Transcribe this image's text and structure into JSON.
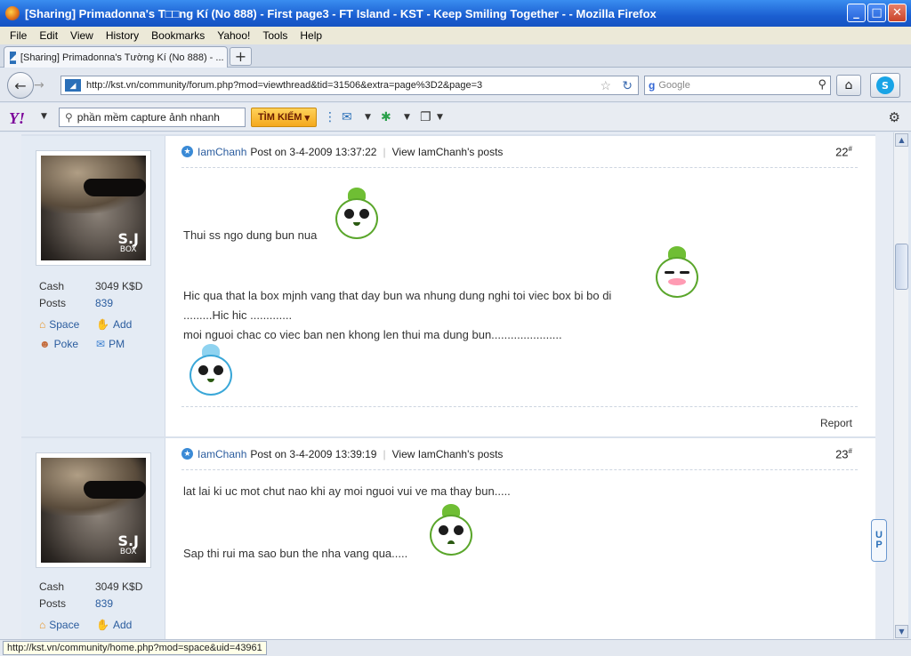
{
  "window": {
    "title": "[Sharing] Primadonna's T□□ng Kí (No 888) - First page3 - FT Island - KST - Keep Smiling Together - - Mozilla Firefox",
    "minimize": "_",
    "maximize": "□",
    "close": "✕"
  },
  "menu": {
    "items": [
      "File",
      "Edit",
      "View",
      "History",
      "Bookmarks",
      "Yahoo!",
      "Tools",
      "Help"
    ]
  },
  "tabs": [
    {
      "label": "[Sharing] Primadonna's Tường Kí (No 888) - ..."
    }
  ],
  "new_tab": "+",
  "nav": {
    "back": "←",
    "forward": "→",
    "url": "http://kst.vn/community/forum.php?mod=viewthread&tid=31506&extra=page%3D2&page=3",
    "search_placeholder": "Google",
    "search_engine_icon": "google-icon",
    "home_icon": "home-icon",
    "skype_icon": "skype-icon"
  },
  "yahoo_toolbar": {
    "logo": "Y!",
    "search_value": "phần mềm capture ảnh nhanh",
    "search_button": "TÌM KIẾM"
  },
  "posts": [
    {
      "author": "IamChanh",
      "posted": "Post on 3-4-2009 13:37:22",
      "view_posts": "View IamChanh's posts",
      "floor": "22",
      "floor_mark": "#",
      "cash_label": "Cash",
      "cash_value": "3049 K$D",
      "posts_label": "Posts",
      "posts_value": "839",
      "actions": [
        "Space",
        "Add",
        "Poke",
        "PM"
      ],
      "lines": [
        "Thui ss ngo dung bun nua",
        "Hic qua that la box mjnh vang that day bun wa nhung dung nghi toi viec box bi bo di",
        ".........Hic hic .............",
        "moi nguoi chac co viec ban nen khong len thui ma dung bun......................"
      ],
      "report": "Report"
    },
    {
      "author": "IamChanh",
      "posted": "Post on 3-4-2009 13:39:19",
      "view_posts": "View IamChanh's posts",
      "floor": "23",
      "floor_mark": "#",
      "cash_label": "Cash",
      "cash_value": "3049 K$D",
      "posts_label": "Posts",
      "posts_value": "839",
      "actions": [
        "Space",
        "Add"
      ],
      "lines": [
        "lat lai ki uc mot chut nao khi ay moi nguoi vui ve ma thay bun.....",
        "Sap thi rui ma sao bun the nha vang qua....."
      ]
    }
  ],
  "avatar_logo": {
    "top": "S.J",
    "bottom": "BOX"
  },
  "up_tab": [
    "U",
    "P"
  ],
  "status": {
    "text": "http://kst.vn/community/home.php?mod=space&uid=43961"
  }
}
